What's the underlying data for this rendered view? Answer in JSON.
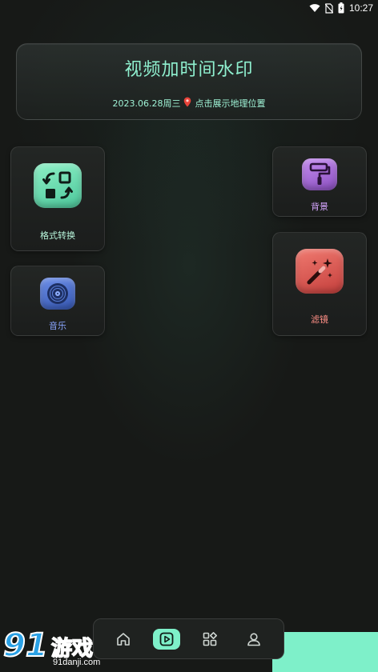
{
  "status_bar": {
    "time": "10:27"
  },
  "header": {
    "title": "视频加时间水印",
    "date": "2023.06.28周三",
    "location_prompt": "点击展示地理位置"
  },
  "features": {
    "format_convert": {
      "label": "格式转换",
      "icon": "format-convert-icon",
      "color": "#6fe0b4"
    },
    "music": {
      "label": "音乐",
      "icon": "music-disc-icon",
      "color": "#4a6fd0"
    },
    "background": {
      "label": "背景",
      "icon": "paint-roller-icon",
      "color": "#b070e0"
    },
    "filter": {
      "label": "滤镜",
      "icon": "magic-wand-icon",
      "color": "#e05a55"
    }
  },
  "bottom_nav": {
    "items": [
      {
        "icon": "home-icon",
        "active": false
      },
      {
        "icon": "play-icon",
        "active": true
      },
      {
        "icon": "apps-icon",
        "active": false
      },
      {
        "icon": "user-icon",
        "active": false
      }
    ],
    "accent": "#7ef0c9"
  },
  "watermark": {
    "logo": "91",
    "text": "游戏",
    "url": "91danji.com"
  }
}
